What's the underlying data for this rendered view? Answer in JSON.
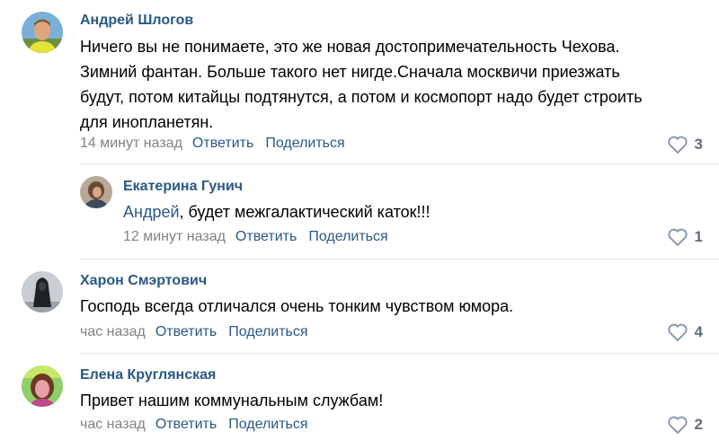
{
  "comments": [
    {
      "author": "Андрей Шлогов",
      "text_lines": [
        "Ничего вы не понимаете, это же новая достопримечательность Чехова.",
        "Зимний фантан. Больше такого нет нигде.Сначала москвичи приезжать",
        "будут, потом китайцы подтянутся, а потом и космопорт надо будет строить",
        "для инопланетян."
      ],
      "time": "14 минут назад",
      "reply_label": "Ответить",
      "share_label": "Поделиться",
      "likes": "3"
    },
    {
      "author": "Екатерина Гунич",
      "mention": "Андрей",
      "text": ", будет межгалактический каток!!!",
      "time": "12 минут назад",
      "reply_label": "Ответить",
      "share_label": "Поделиться",
      "likes": "1"
    },
    {
      "author": "Харон Смэртович",
      "text": "Господь всегда отличался очень тонким чувством юмора.",
      "time": "час назад",
      "reply_label": "Ответить",
      "share_label": "Поделиться",
      "likes": "4"
    },
    {
      "author": "Елена Круглянская",
      "text": "Привет нашим коммунальным службам!",
      "time": "час назад",
      "reply_label": "Ответить",
      "share_label": "Поделиться",
      "likes": "2"
    }
  ],
  "colors": {
    "link": "#2a5885",
    "meta": "#828282",
    "like_icon": "#8a9ab0",
    "divider": "#e4e6ea"
  },
  "icons": {
    "like": "heart-icon"
  }
}
